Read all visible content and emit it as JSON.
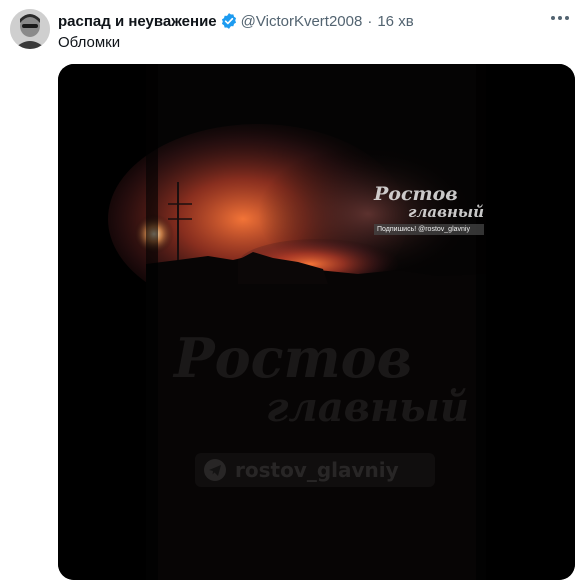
{
  "tweet": {
    "author_name": "распад и неуважение",
    "handle": "@VictorKvert2008",
    "separator": "·",
    "time": "16 хв",
    "text": "Обломки",
    "verified_color": "#1d9bf0",
    "icons": {
      "avatar": "avatar-photo",
      "verified": "verified-badge-icon",
      "more": "more-options-icon"
    }
  },
  "media": {
    "watermark_small_line1": "Ростов",
    "watermark_small_line2": "главный",
    "watermark_small_sub": "Подпишись! @rostov_glavniy",
    "watermark_big_line1": "Ростов",
    "watermark_big_line2": "главный",
    "watermark_telegram": "rostov_glavniy",
    "fire_color": "#e0502a"
  }
}
